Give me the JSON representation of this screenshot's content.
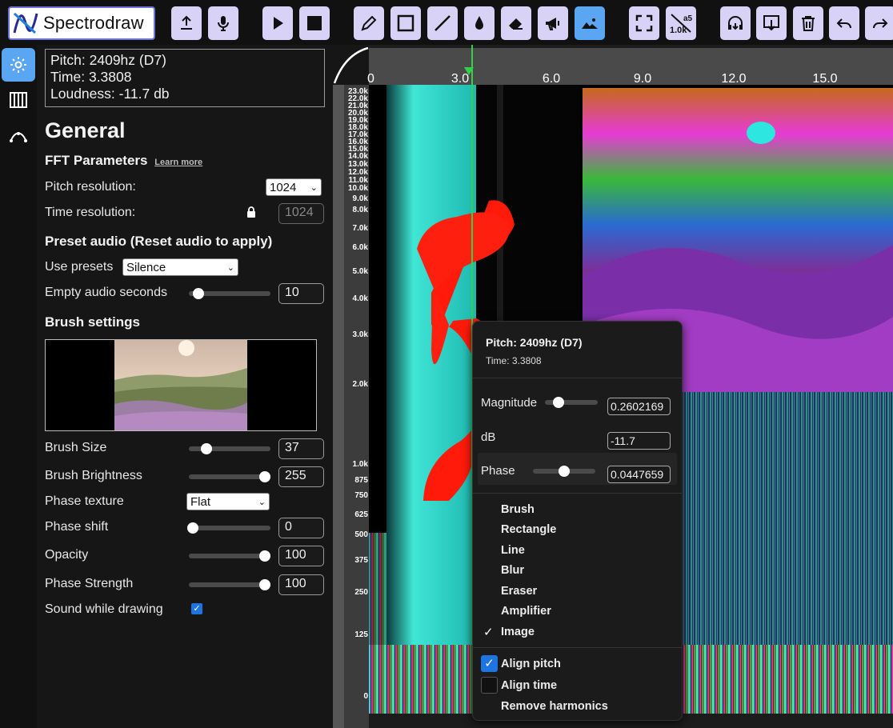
{
  "app": {
    "name": "Spectrodraw"
  },
  "toolbar": {
    "buttons": [
      {
        "name": "upload-button",
        "icon": "upload-icon"
      },
      {
        "name": "record-button",
        "icon": "microphone-icon"
      },
      {
        "name": "play-button",
        "icon": "play-icon"
      },
      {
        "name": "stop-button",
        "icon": "stop-icon"
      },
      {
        "name": "brush-tool-button",
        "icon": "pencil-icon"
      },
      {
        "name": "rectangle-tool-button",
        "icon": "rectangle-icon"
      },
      {
        "name": "line-tool-button",
        "icon": "line-icon"
      },
      {
        "name": "blur-tool-button",
        "icon": "drop-icon"
      },
      {
        "name": "eraser-tool-button",
        "icon": "eraser-icon"
      },
      {
        "name": "amplifier-tool-button",
        "icon": "megaphone-icon"
      },
      {
        "name": "image-tool-button",
        "icon": "image-icon",
        "active": true
      },
      {
        "name": "fullscreen-button",
        "icon": "fullscreen-icon"
      },
      {
        "name": "frequency-range-button",
        "icon": "frequency-range-icon"
      },
      {
        "name": "listen-button",
        "icon": "headphones-icon"
      },
      {
        "name": "download-button",
        "icon": "download-icon"
      },
      {
        "name": "clear-button",
        "icon": "trash-icon"
      },
      {
        "name": "undo-button",
        "icon": "undo-icon"
      },
      {
        "name": "redo-button",
        "icon": "redo-icon"
      }
    ],
    "freq_button": {
      "top": "a5",
      "bottom": "1.0k"
    }
  },
  "rail": [
    {
      "name": "settings-tab",
      "icon": "gear-icon",
      "active": true
    },
    {
      "name": "piano-tab",
      "icon": "piano-icon"
    },
    {
      "name": "curve-tab",
      "icon": "curve-icon"
    }
  ],
  "info": {
    "pitch": "Pitch: 2409hz (D7)",
    "time": "Time: 3.3808",
    "loudness": "Loudness: -11.7 db"
  },
  "panel": {
    "title": "General",
    "fft": {
      "heading": "FFT Parameters",
      "learn_more": "Learn more",
      "pitch_label": "Pitch resolution:",
      "pitch_value": "1024",
      "time_label": "Time resolution:",
      "time_value": "1024"
    },
    "preset": {
      "heading": "Preset audio (Reset audio to apply)",
      "use_label": "Use presets",
      "use_value": "Silence",
      "empty_label": "Empty audio seconds",
      "empty_value": "10",
      "empty_level": 0.12
    },
    "brush": {
      "heading": "Brush settings",
      "rows": [
        {
          "label": "Brush Size",
          "value": "37",
          "level": 0.22
        },
        {
          "label": "Brush Brightness",
          "value": "255",
          "level": 0.93
        },
        {
          "label": "Phase shift",
          "value": "0",
          "level": 0.05
        },
        {
          "label": "Opacity",
          "value": "100",
          "level": 0.93
        },
        {
          "label": "Phase Strength",
          "value": "100",
          "level": 0.93
        }
      ],
      "phase_texture_label": "Phase texture",
      "phase_texture_value": "Flat",
      "sound_label": "Sound while drawing",
      "sound_checked": true
    }
  },
  "timeline": {
    "ticks": [
      "0",
      "3.0",
      "6.0",
      "9.0",
      "12.0",
      "15.0"
    ],
    "playhead_time": 3.3808
  },
  "freq_labels": [
    "23.0k",
    "22.0k",
    "21.0k",
    "20.0k",
    "19.0k",
    "18.0k",
    "17.0k",
    "16.0k",
    "15.0k",
    "14.0k",
    "13.0k",
    "12.0k",
    "11.0k",
    "10.0k",
    "9.0k",
    "8.0k",
    "7.0k",
    "6.0k",
    "5.0k",
    "4.0k",
    "3.0k",
    "2.0k",
    "1.0k",
    "875",
    "750",
    "625",
    "500",
    "375",
    "250",
    "125",
    "0"
  ],
  "popup": {
    "pitch": "Pitch: 2409hz (D7)",
    "time": "Time: 3.3808",
    "magnitude_label": "Magnitude",
    "magnitude_value": "0.2602169",
    "magnitude_level": 0.26,
    "db_label": "dB",
    "db_value": "-11.7",
    "phase_label": "Phase",
    "phase_value": "0.0447659",
    "phase_level": 0.5,
    "tools": [
      "Brush",
      "Rectangle",
      "Line",
      "Blur",
      "Eraser",
      "Amplifier",
      "Image"
    ],
    "selected_tool": "Image",
    "align_pitch_label": "Align pitch",
    "align_pitch_checked": true,
    "align_time_label": "Align time",
    "align_time_checked": false,
    "remove_harmonics_label": "Remove harmonics"
  },
  "colors": {
    "accent": "#5aa6f2",
    "button_bg": "#d9d2f7",
    "playhead": "#33d14a",
    "checkbox": "#1e74e0"
  }
}
